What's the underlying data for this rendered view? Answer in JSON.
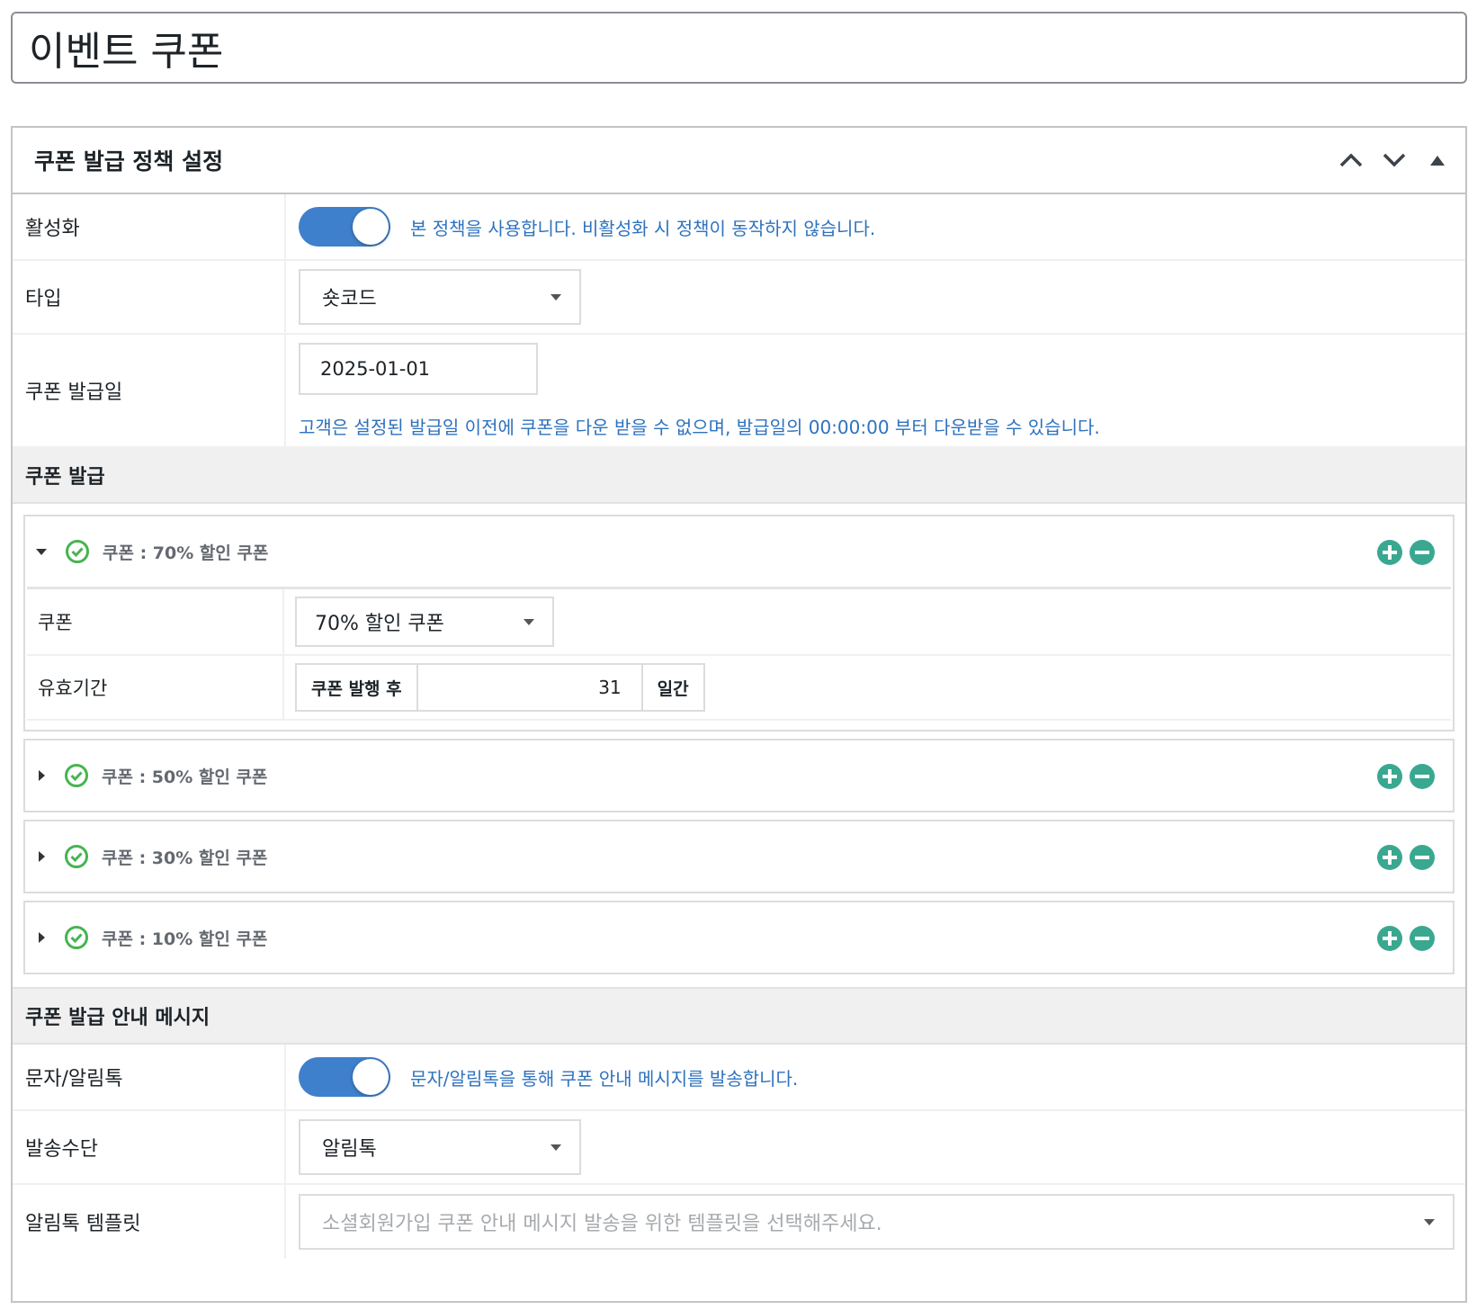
{
  "page": {
    "title": "이벤트 쿠폰"
  },
  "panel": {
    "title": "쿠폰 발급 정책 설정",
    "controls": [
      "chevron-up-icon",
      "chevron-down-icon",
      "triangle-up-icon"
    ]
  },
  "policy": {
    "activation": {
      "label": "활성화",
      "enabled": true,
      "hint": "본 정책을 사용합니다. 비활성화 시 정책이 동작하지 않습니다."
    },
    "type": {
      "label": "타입",
      "value": "숏코드"
    },
    "issue_date": {
      "label": "쿠폰 발급일",
      "value": "2025-01-01",
      "hint": "고객은 설정된 발급일 이전에 쿠폰을 다운 받을 수 없으며, 발급일의 00:00:00 부터 다운받을 수 있습니다."
    }
  },
  "issue_section": {
    "title": "쿠폰 발급",
    "coupons": [
      {
        "title": "쿠폰 : 70% 할인 쿠폰",
        "expanded": true
      },
      {
        "title": "쿠폰 : 50% 할인 쿠폰",
        "expanded": false
      },
      {
        "title": "쿠폰 : 30% 할인 쿠폰",
        "expanded": false
      },
      {
        "title": "쿠폰 : 10% 할인 쿠폰",
        "expanded": false
      }
    ],
    "expanded_detail": {
      "coupon_label": "쿠폰",
      "coupon_value": "70% 할인 쿠폰",
      "validity_label": "유효기간",
      "validity_prefix": "쿠폰 발행 후",
      "validity_days": "31",
      "validity_suffix": "일간"
    }
  },
  "message_section": {
    "title": "쿠폰 발급 안내 메시지",
    "sms": {
      "label": "문자/알림톡",
      "enabled": true,
      "hint": "문자/알림톡을 통해 쿠폰 안내 메시지를 발송합니다."
    },
    "method": {
      "label": "발송수단",
      "value": "알림톡"
    },
    "template": {
      "label": "알림톡 템플릿",
      "placeholder": "소셜회원가입 쿠폰 안내 메시지 발송을 위한 템플릿을 선택해주세요."
    }
  },
  "colors": {
    "accent": "#3f80cc",
    "hint": "#2e72be",
    "check": "#46b450",
    "action": "#3aa890"
  }
}
